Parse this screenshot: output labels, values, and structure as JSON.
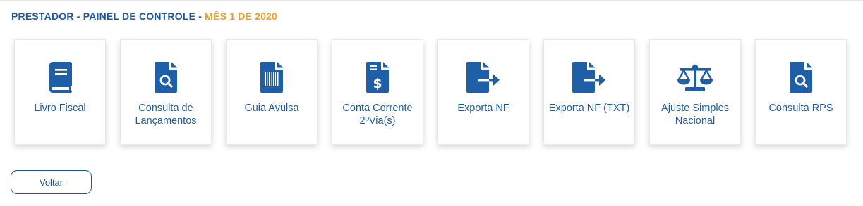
{
  "header": {
    "title_main": "PRESTADOR - PAINEL DE CONTROLE - ",
    "title_period": "MÊS 1 DE 2020"
  },
  "colors": {
    "primary": "#1a5aa0",
    "accent": "#f0a01e",
    "icon": "#1e5fa8"
  },
  "cards": [
    {
      "label": "Livro Fiscal",
      "icon": "book-icon"
    },
    {
      "label": "Consulta de Lançamentos",
      "icon": "file-search-icon"
    },
    {
      "label": "Guia Avulsa",
      "icon": "file-barcode-icon"
    },
    {
      "label": "Conta Corrente 2ºVia(s)",
      "icon": "file-dollar-icon"
    },
    {
      "label": "Exporta NF",
      "icon": "file-export-icon"
    },
    {
      "label": "Exporta NF (TXT)",
      "icon": "file-export-icon"
    },
    {
      "label": "Ajuste Simples Nacional",
      "icon": "balance-scale-icon"
    },
    {
      "label": "Consulta RPS",
      "icon": "file-search-icon"
    }
  ],
  "footer": {
    "back_label": "Voltar"
  }
}
